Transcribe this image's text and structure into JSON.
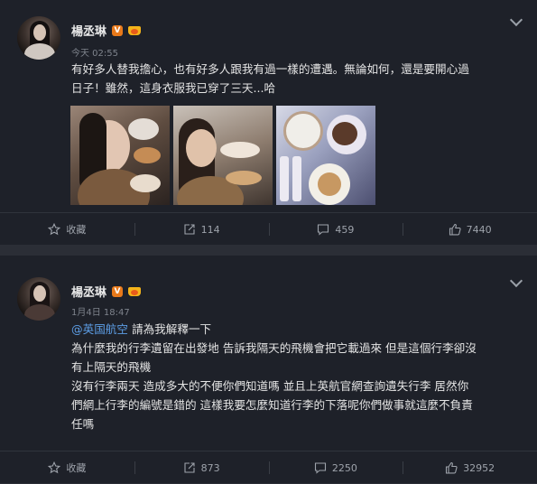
{
  "posts": [
    {
      "author": "楊丞琳",
      "time": "今天 02:55",
      "text_line1": "有好多人替我擔心，也有好多人跟我有過一樣的遭遇。無論如何，還是要開心過",
      "text_line2": "日子！雖然，這身衣服我已穿了三天...哈",
      "actions": {
        "favorite": "收藏",
        "share": "114",
        "comment": "459",
        "like": "7440"
      }
    },
    {
      "author": "楊丞琳",
      "time": "1月4日 18:47",
      "mention": "@英国航空",
      "mention_suffix": " 請為我解釋一下",
      "text_line2": "為什麼我的行李遺留在出發地 告訴我隔天的飛機會把它載過來 但是這個行李卻沒",
      "text_line3": "有上隔天的飛機",
      "text_line4": "沒有行李兩天 造成多大的不便你們知道嗎 並且上英航官網查詢遺失行李 居然你",
      "text_line5": "們網上行李的編號是錯的 這樣我要怎麼知道行李的下落呢你們做事就這麼不負責",
      "text_line6": "任嗎",
      "actions": {
        "favorite": "收藏",
        "share": "873",
        "comment": "2250",
        "like": "32952"
      }
    }
  ],
  "icons": {
    "verified": "V",
    "favorite": "star-icon",
    "share": "share-icon",
    "comment": "comment-icon",
    "like": "thumbs-up-icon"
  },
  "colors": {
    "background": "#1e2129",
    "separator": "#2b2e36",
    "mention": "#5d9ee6",
    "verified": "#e8791a"
  }
}
